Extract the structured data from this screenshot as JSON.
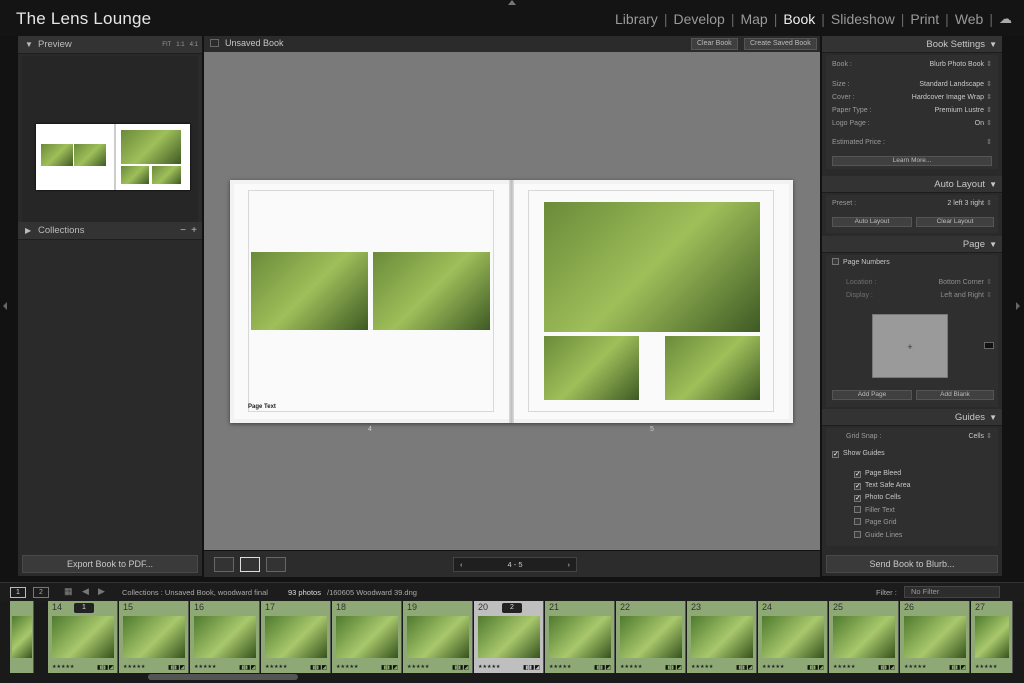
{
  "app": {
    "brand": "The Lens Lounge"
  },
  "modules": [
    "Library",
    "Develop",
    "Map",
    "Book",
    "Slideshow",
    "Print",
    "Web"
  ],
  "active_module": "Book",
  "left_panel": {
    "preview_title": "Preview",
    "zoom": [
      "FIT",
      "1:1",
      "4:1"
    ],
    "collections_title": "Collections",
    "export_label": "Export Book to PDF..."
  },
  "center": {
    "title": "Unsaved Book",
    "clear_label": "Clear Book",
    "create_label": "Create Saved Book",
    "page_text": "Page Text",
    "left_page_num": "4",
    "right_page_num": "5",
    "pager": "4  -  5"
  },
  "book_settings": {
    "title": "Book Settings",
    "book_label": "Book :",
    "book_value": "Blurb Photo Book",
    "size_label": "Size :",
    "size_value": "Standard Landscape",
    "cover_label": "Cover :",
    "cover_value": "Hardcover Image Wrap",
    "paper_label": "Paper Type :",
    "paper_value": "Premium Lustre",
    "logo_label": "Logo Page :",
    "logo_value": "On",
    "price_label": "Estimated Price :",
    "learn_more": "Learn More..."
  },
  "auto_layout": {
    "title": "Auto Layout",
    "preset_label": "Preset :",
    "preset_value": "2 left 3 right",
    "auto_btn": "Auto Layout",
    "clear_btn": "Clear Layout"
  },
  "page": {
    "title": "Page",
    "numbers_label": "Page Numbers",
    "location_label": "Location :",
    "location_value": "Bottom Corner",
    "display_label": "Display :",
    "display_value": "Left and Right",
    "add_page": "Add Page",
    "add_blank": "Add Blank"
  },
  "guides": {
    "title": "Guides",
    "snap_label": "Grid Snap :",
    "snap_value": "Cells",
    "show_guides": "Show Guides",
    "items": [
      {
        "label": "Page Bleed",
        "checked": true
      },
      {
        "label": "Text Safe Area",
        "checked": true
      },
      {
        "label": "Photo Cells",
        "checked": true
      },
      {
        "label": "Filler Text",
        "checked": false
      },
      {
        "label": "Page Grid",
        "checked": false
      },
      {
        "label": "Guide Lines",
        "checked": false
      }
    ]
  },
  "send_label": "Send Book to Blurb...",
  "filmbar": {
    "screen1": "1",
    "screen2": "2",
    "source": "Collections : Unsaved Book, woodward final",
    "count": "93 photos",
    "file": "/160605 Woodward 39.dng",
    "filter_label": "Filter :",
    "filter_value": "No Filter"
  },
  "filmstrip": {
    "frames": [
      "14",
      "15",
      "16",
      "17",
      "18",
      "19",
      "20",
      "21",
      "22",
      "23",
      "24",
      "25",
      "26",
      "27"
    ],
    "badges": [
      "1",
      "2"
    ]
  },
  "colors": {
    "accent": "#8ea876",
    "panel": "#2a2a2a"
  }
}
